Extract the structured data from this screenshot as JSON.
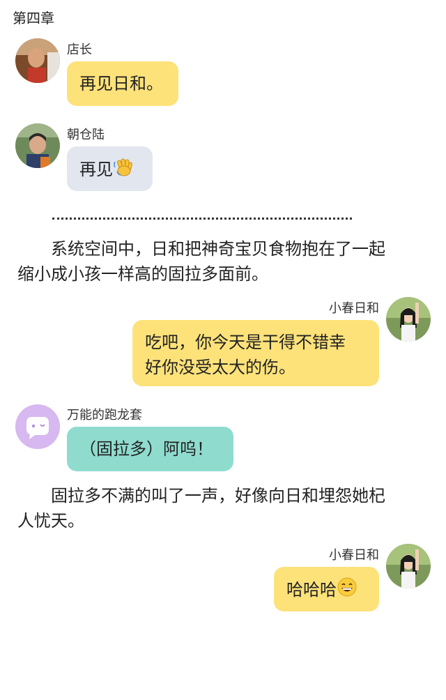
{
  "chapter_title": "第四章",
  "messages": [
    {
      "speaker": "店长",
      "text": "再见日和。"
    },
    {
      "speaker": "朝仓陆",
      "text": "再见",
      "emoji": "waving-hand"
    },
    {
      "speaker": "小春日和",
      "text_line1": "吃吧，你今天是干得不错幸",
      "text_line2": "好你没受太大的伤。"
    },
    {
      "speaker": "万能的跑龙套",
      "text": "（固拉多）阿呜！"
    },
    {
      "speaker": "小春日和",
      "text": "哈哈哈",
      "emoji": "grinning-face"
    }
  ],
  "narration": [
    {
      "line1": "　　系统空间中，日和把神奇宝贝食物抱在了一起",
      "line2": "缩小成小孩一样高的固拉多面前。"
    },
    {
      "line1": "　　固拉多不满的叫了一声，好像向日和埋怨她杞",
      "line2": "人忧天。"
    }
  ],
  "colors": {
    "yellow_bubble": "#fde27a",
    "grey_bubble": "#e2e6ef",
    "teal_bubble": "#8fdccf",
    "purple_avatar": "#d7b8f0"
  }
}
